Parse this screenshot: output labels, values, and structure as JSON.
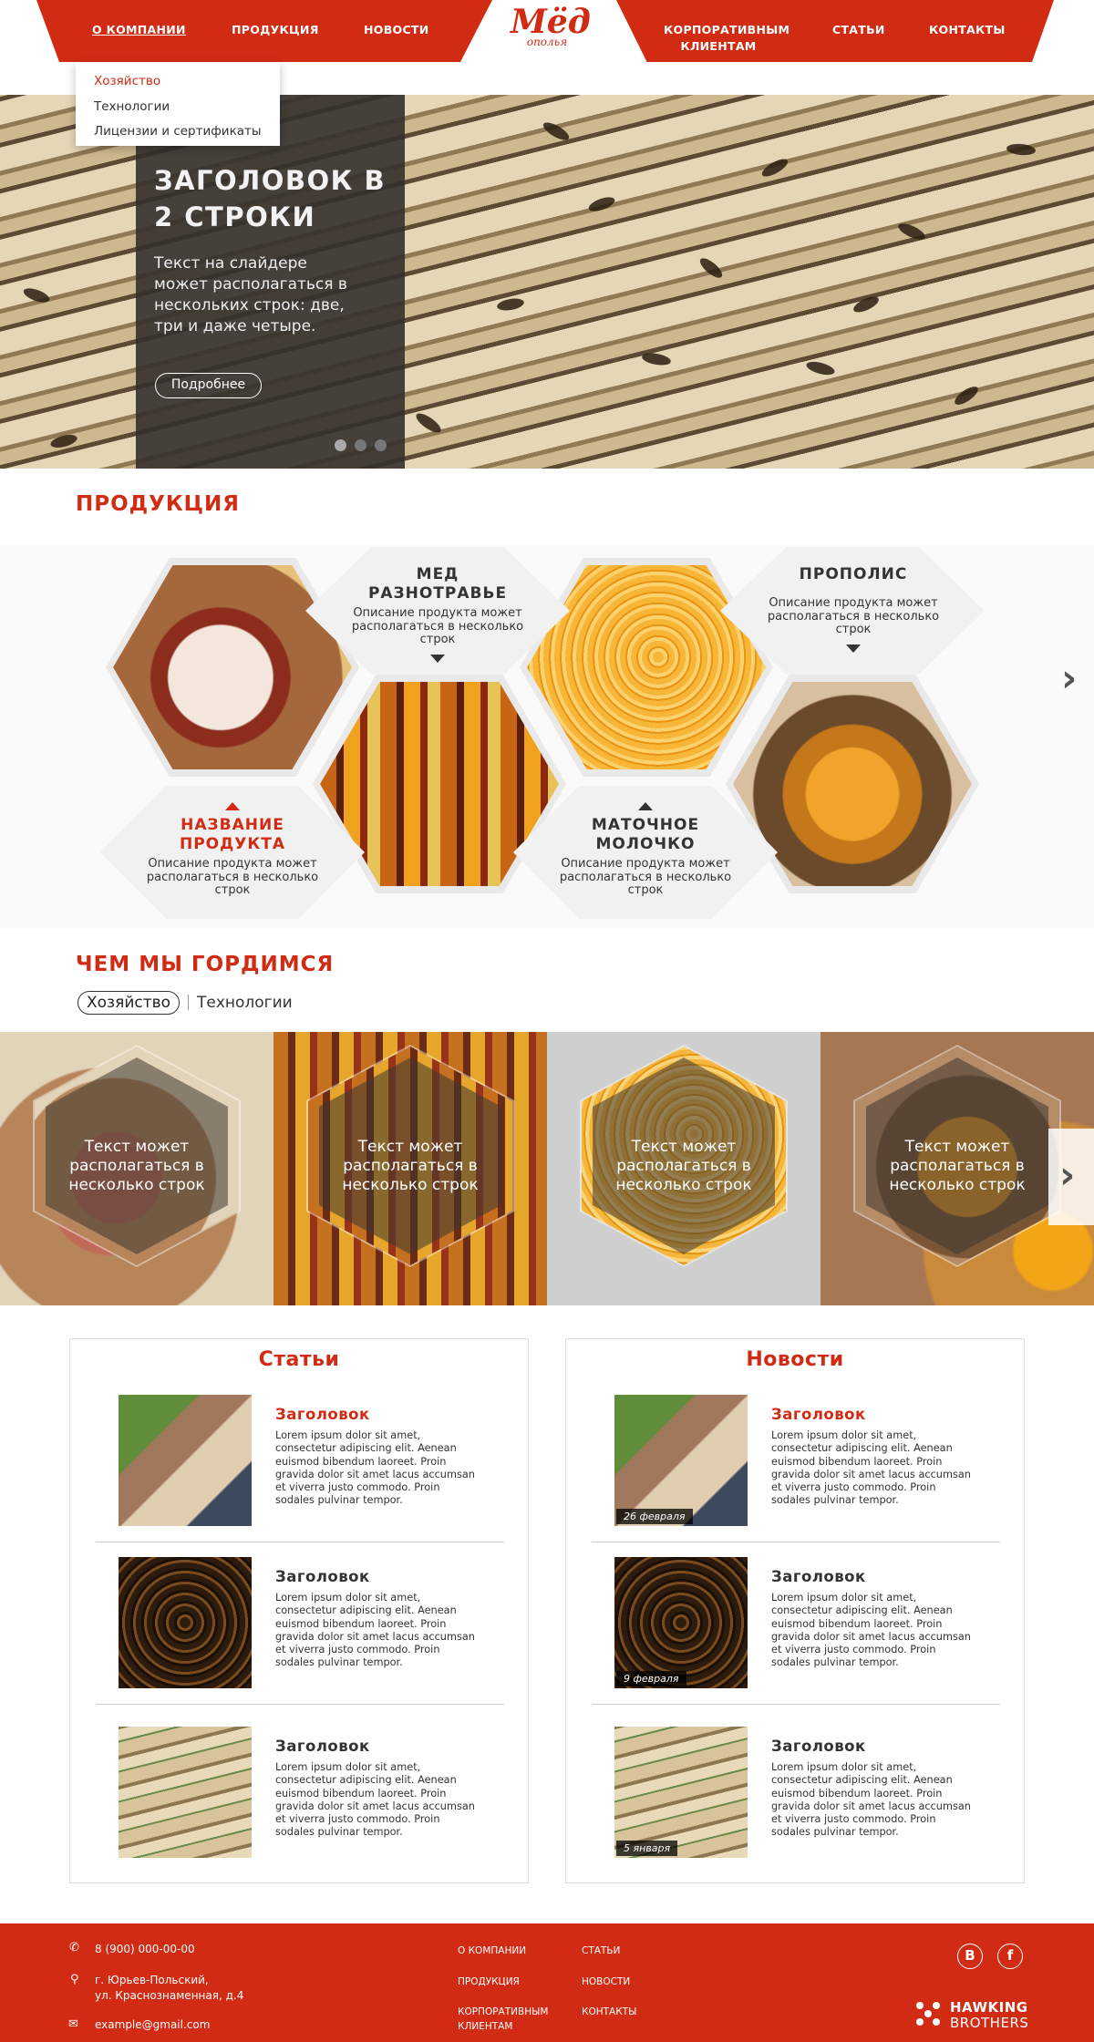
{
  "nav": {
    "left": [
      "О компании",
      "Продукция",
      "Новости"
    ],
    "right": [
      "Корпоративным клиентам",
      "Статьи",
      "Контакты"
    ],
    "logo_main": "Мёд",
    "logo_sub": "ополья"
  },
  "dropdown": {
    "items": [
      "Хозяйство",
      "Технологии",
      "Лицензии и сертификаты"
    ]
  },
  "hero": {
    "title": "Заголовок в 2 строки",
    "text": "Текст на слайдере может располагаться в нескольких строк: две, три и даже четыре.",
    "button": "Подробнее",
    "slides": 3,
    "active_slide": 1
  },
  "products": {
    "title": "Продукция",
    "items": [
      {
        "name": "Мед разнотравье",
        "desc": "Описание продукта может располагаться в несколько строк"
      },
      {
        "name": "Прополис",
        "desc": "Описание продукта может располагаться в несколько строк"
      },
      {
        "name": "Название продукта",
        "desc": "Описание продукта может располагаться в несколько строк"
      },
      {
        "name": "Маточное молочко",
        "desc": "Описание продукта может располагаться в несколько строк"
      }
    ]
  },
  "pride": {
    "title": "Чем мы гордимся",
    "tabs": [
      "Хозяйство",
      "Технологии"
    ],
    "tiles": [
      "Текст может располагаться в несколько строк",
      "Текст может располагаться в несколько строк",
      "Текст может располагаться в несколько строк",
      "Текст может располагаться в несколько строк"
    ]
  },
  "articles": {
    "title": "Статьи",
    "items": [
      {
        "title": "Заголовок",
        "text": "Lorem ipsum dolor sit amet, consectetur adipiscing elit. Aenean euismod bibendum laoreet. Proin gravida dolor sit amet lacus accumsan et viverra justo commodo. Proin sodales pulvinar tempor."
      },
      {
        "title": "Заголовок",
        "text": "Lorem ipsum dolor sit amet, consectetur adipiscing elit. Aenean euismod bibendum laoreet. Proin gravida dolor sit amet lacus accumsan et viverra justo commodo. Proin sodales pulvinar tempor."
      },
      {
        "title": "Заголовок",
        "text": "Lorem ipsum dolor sit amet, consectetur adipiscing elit. Aenean euismod bibendum laoreet. Proin gravida dolor sit amet lacus accumsan et viverra justo commodo. Proin sodales pulvinar tempor."
      }
    ]
  },
  "news": {
    "title": "Новости",
    "items": [
      {
        "title": "Заголовок",
        "date": "26 февраля",
        "text": "Lorem ipsum dolor sit amet, consectetur adipiscing elit. Aenean euismod bibendum laoreet. Proin gravida dolor sit amet lacus accumsan et viverra justo commodo. Proin sodales pulvinar tempor."
      },
      {
        "title": "Заголовок",
        "date": "9 февраля",
        "text": "Lorem ipsum dolor sit amet, consectetur adipiscing elit. Aenean euismod bibendum laoreet. Proin gravida dolor sit amet lacus accumsan et viverra justo commodo. Proin sodales pulvinar tempor."
      },
      {
        "title": "Заголовок",
        "date": "5 января",
        "text": "Lorem ipsum dolor sit amet, consectetur adipiscing elit. Aenean euismod bibendum laoreet. Proin gravida dolor sit amet lacus accumsan et viverra justo commodo. Proin sodales pulvinar tempor."
      }
    ]
  },
  "footer": {
    "phone": "8 (900) 000-00-00",
    "address_1": "г. Юрьев-Польский,",
    "address_2": "ул. Краснознаменная, д.4",
    "email": "example@gmail.com",
    "links_col1": [
      "О компании",
      "Продукция",
      "Корпоративным клиентам"
    ],
    "links_col2": [
      "Статьи",
      "Новости",
      "Контакты"
    ],
    "social": [
      "В",
      "f"
    ],
    "brand_1": "HAWKING",
    "brand_2": "BROTHERS"
  },
  "colors": {
    "accent": "#d22b14",
    "dark_panel": "#34302c",
    "text": "#333333"
  },
  "icons": {
    "phone": "phone-icon",
    "location": "location-pin-icon",
    "email": "envelope-icon",
    "next": "chevron-right-icon"
  }
}
